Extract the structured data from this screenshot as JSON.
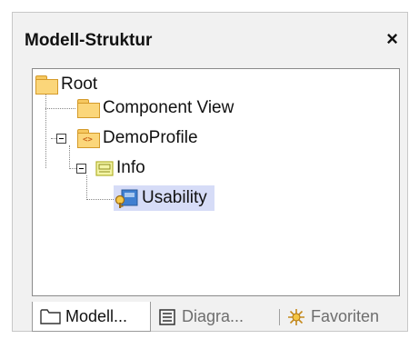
{
  "panel": {
    "title": "Modell-Struktur",
    "close_glyph": "×"
  },
  "tree": {
    "nodes": [
      {
        "label": "Root",
        "icon": "folder-icon"
      },
      {
        "label": "Component View",
        "icon": "folder-icon"
      },
      {
        "label": "DemoProfile",
        "icon": "profile-folder-icon",
        "expanded": true
      },
      {
        "label": "Info",
        "icon": "package-icon",
        "expanded": true
      },
      {
        "label": "Usability",
        "icon": "stereotype-icon",
        "selected": true
      }
    ]
  },
  "tabs": [
    {
      "label": "Modell...",
      "icon": "folder-icon",
      "active": true
    },
    {
      "label": "Diagra...",
      "icon": "diagram-tree-icon",
      "active": false
    },
    {
      "label": "Favoriten",
      "icon": "star-burst-icon",
      "active": false
    }
  ],
  "colors": {
    "selection": "#d6dcf7",
    "folder": "#fbd67a",
    "accent_tag": "#c9641a"
  }
}
